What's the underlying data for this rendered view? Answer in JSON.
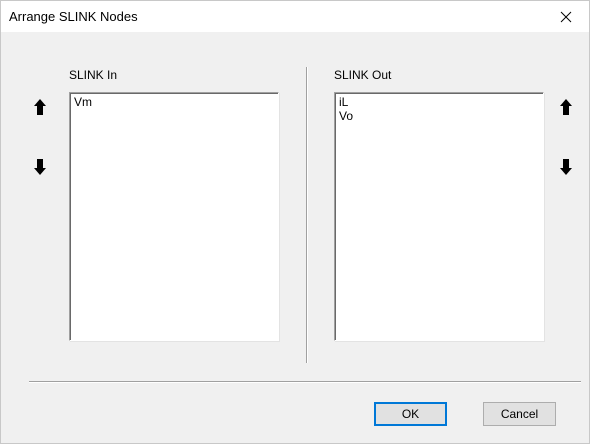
{
  "window": {
    "title": "Arrange SLINK Nodes"
  },
  "slink_in": {
    "label": "SLINK In",
    "items": [
      "Vm"
    ]
  },
  "slink_out": {
    "label": "SLINK Out",
    "items": [
      "iL",
      "Vo"
    ]
  },
  "buttons": {
    "ok_label": "OK",
    "cancel_label": "Cancel"
  },
  "icons": {
    "close": "close-icon",
    "move_up": "arrow-up-icon",
    "move_down": "arrow-down-icon"
  },
  "colors": {
    "arrow": "#000000",
    "dialog_bg": "#f0f0f0",
    "default_button_border": "#0078d7"
  }
}
